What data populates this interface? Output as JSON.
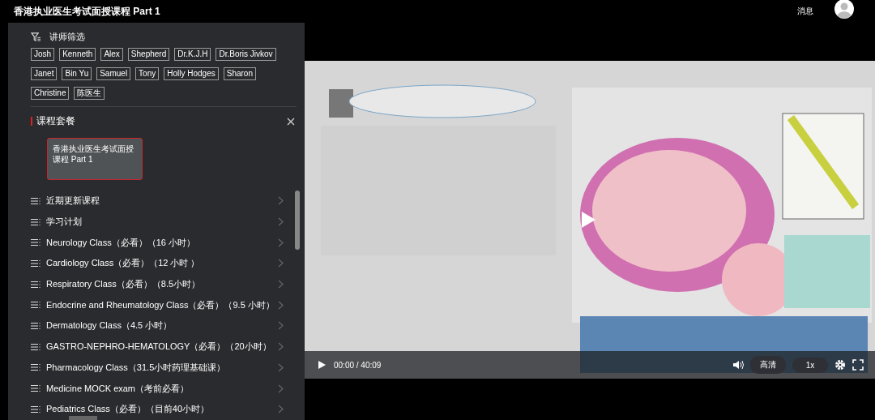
{
  "header": {
    "title": "香港执业医生考试面授课程 Part 1",
    "messages": "消息"
  },
  "instructor_filter": {
    "title": "讲师筛选",
    "instructors": [
      "Josh",
      "Kenneth",
      "Alex",
      "Shepherd",
      "Dr.K.J.H",
      "Dr.Boris Jivkov",
      "Janet",
      "Bin Yu",
      "Samuel",
      "Tony",
      "Holly Hodges",
      "Sharon",
      "Christine",
      "陈医生"
    ]
  },
  "course_packages": {
    "title": "课程套餐",
    "packages": [
      {
        "title": "香港执业医生考试面授课程 Part 1",
        "selected": true
      }
    ]
  },
  "courses": [
    "近期更新课程",
    "学习计划",
    "Neurology Class（必看）（16 小时）",
    "Cardiology Class（必看）（12 小时 ）",
    "Respiratory Class（必看）（8.5小时）",
    "Endocrine and Rheumatology Class（必看）（9.5 小时）",
    "Dermatology Class（4.5 小时）",
    "GASTRO-NEPHRO-HEMATOLOGY（必看）（20小时）",
    "Pharmacology Class（31.5小时药理基础课）",
    "Medicine MOCK exam（考前必看）",
    "Pediatrics Class（必看）（目前40小时）"
  ],
  "player": {
    "time": "00:00 / 40:09",
    "quality": "高清",
    "speed": "1x"
  }
}
